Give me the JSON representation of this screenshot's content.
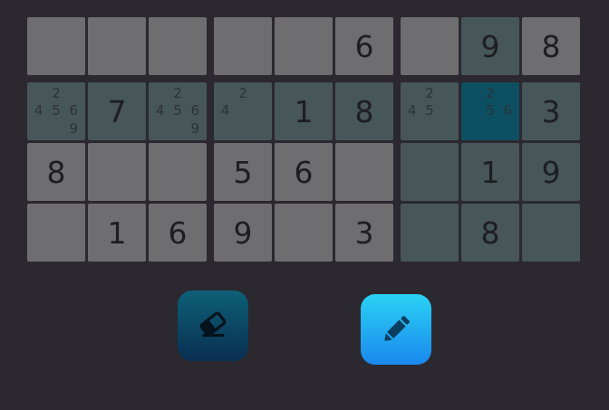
{
  "colors": {
    "background": "#2b2830",
    "cell_default": "#6e6e70",
    "cell_related": "#475659",
    "cell_selected": "#0d4f62",
    "digit": "#1e1e22",
    "note": "#2a3438"
  },
  "board": {
    "rows": [
      [
        {
          "value": "",
          "notes": [],
          "state": "default"
        },
        {
          "value": "",
          "notes": [],
          "state": "default"
        },
        {
          "value": "",
          "notes": [],
          "state": "default"
        },
        {
          "value": "",
          "notes": [],
          "state": "default"
        },
        {
          "value": "",
          "notes": [],
          "state": "default"
        },
        {
          "value": "6",
          "notes": [],
          "state": "default"
        },
        {
          "value": "",
          "notes": [],
          "state": "default"
        },
        {
          "value": "9",
          "notes": [],
          "state": "related"
        },
        {
          "value": "8",
          "notes": [],
          "state": "default"
        }
      ],
      [
        {
          "value": "",
          "notes": [
            "",
            "2",
            "",
            "4",
            "5",
            "6",
            "",
            "",
            "9"
          ],
          "state": "related"
        },
        {
          "value": "7",
          "notes": [],
          "state": "related"
        },
        {
          "value": "",
          "notes": [
            "",
            "2",
            "",
            "4",
            "5",
            "6",
            "",
            "",
            "9"
          ],
          "state": "related"
        },
        {
          "value": "",
          "notes": [
            "",
            "2",
            "",
            "4",
            "",
            "",
            "",
            "",
            ""
          ],
          "state": "related"
        },
        {
          "value": "1",
          "notes": [],
          "state": "related"
        },
        {
          "value": "8",
          "notes": [],
          "state": "related"
        },
        {
          "value": "",
          "notes": [
            "",
            "2",
            "",
            "4",
            "5",
            "",
            "",
            "",
            ""
          ],
          "state": "related"
        },
        {
          "value": "",
          "notes": [
            "",
            "2",
            "",
            "",
            "5",
            "6",
            "",
            "",
            ""
          ],
          "state": "selected"
        },
        {
          "value": "3",
          "notes": [],
          "state": "related"
        }
      ],
      [
        {
          "value": "8",
          "notes": [],
          "state": "default"
        },
        {
          "value": "",
          "notes": [],
          "state": "default"
        },
        {
          "value": "",
          "notes": [],
          "state": "default"
        },
        {
          "value": "5",
          "notes": [],
          "state": "default"
        },
        {
          "value": "6",
          "notes": [],
          "state": "default"
        },
        {
          "value": "",
          "notes": [],
          "state": "default"
        },
        {
          "value": "",
          "notes": [],
          "state": "related"
        },
        {
          "value": "1",
          "notes": [],
          "state": "related"
        },
        {
          "value": "9",
          "notes": [],
          "state": "related"
        }
      ],
      [
        {
          "value": "",
          "notes": [],
          "state": "default"
        },
        {
          "value": "1",
          "notes": [],
          "state": "default"
        },
        {
          "value": "6",
          "notes": [],
          "state": "default"
        },
        {
          "value": "9",
          "notes": [],
          "state": "default"
        },
        {
          "value": "",
          "notes": [],
          "state": "default"
        },
        {
          "value": "3",
          "notes": [],
          "state": "default"
        },
        {
          "value": "",
          "notes": [],
          "state": "related"
        },
        {
          "value": "8",
          "notes": [],
          "state": "related"
        },
        {
          "value": "",
          "notes": [],
          "state": "related"
        }
      ]
    ]
  },
  "toolbar": {
    "eraser": {
      "icon": "eraser-icon",
      "active": true
    },
    "pencil": {
      "icon": "pencil-icon",
      "active": false
    }
  }
}
